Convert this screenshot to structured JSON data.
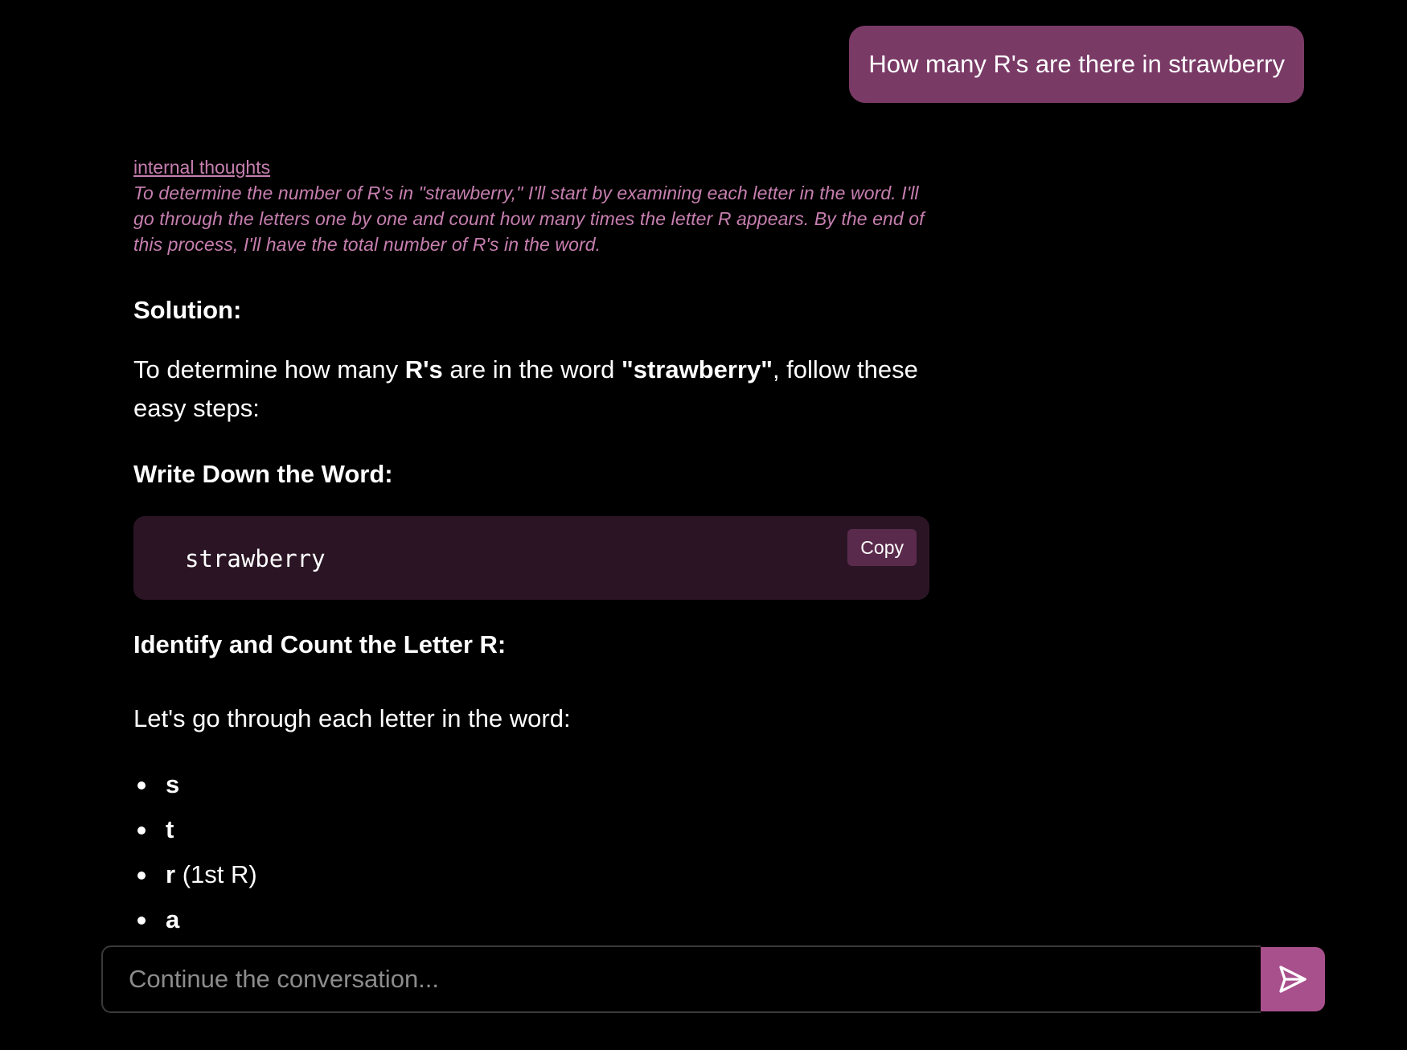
{
  "user_message": {
    "text": "How many R's are there in strawberry"
  },
  "assistant": {
    "thoughts_label": "internal thoughts",
    "thoughts_text": "To determine the number of R's in \"strawberry,\" I'll start by examining each letter in the word. I'll go through the letters one by one and count how many times the letter R appears. By the end of this process, I'll have the total number of R's in the word.",
    "solution_heading": "Solution:",
    "intro": {
      "part1": "To determine how many ",
      "bold1": "R's",
      "part2": " are in the word ",
      "bold2": "\"strawberry\"",
      "part3": ", follow these easy steps:"
    },
    "step1_heading": "Write Down the Word:",
    "code_block": {
      "code": "strawberry",
      "copy_label": "Copy"
    },
    "step2_heading": "Identify and Count the Letter R:",
    "step2_intro": "Let's go through each letter in the word:",
    "letters": [
      {
        "letter": "s",
        "note": ""
      },
      {
        "letter": "t",
        "note": ""
      },
      {
        "letter": "r",
        "note": " (1st R)"
      },
      {
        "letter": "a",
        "note": ""
      }
    ]
  },
  "composer": {
    "placeholder": "Continue the conversation..."
  },
  "colors": {
    "user_bubble": "#7a3a66",
    "accent_text": "#c77fb0",
    "code_bg": "#2b1525",
    "copy_bg": "#5a2a4c",
    "send_bg": "#a8508c"
  },
  "icons": {
    "send": "send-arrow-icon"
  }
}
